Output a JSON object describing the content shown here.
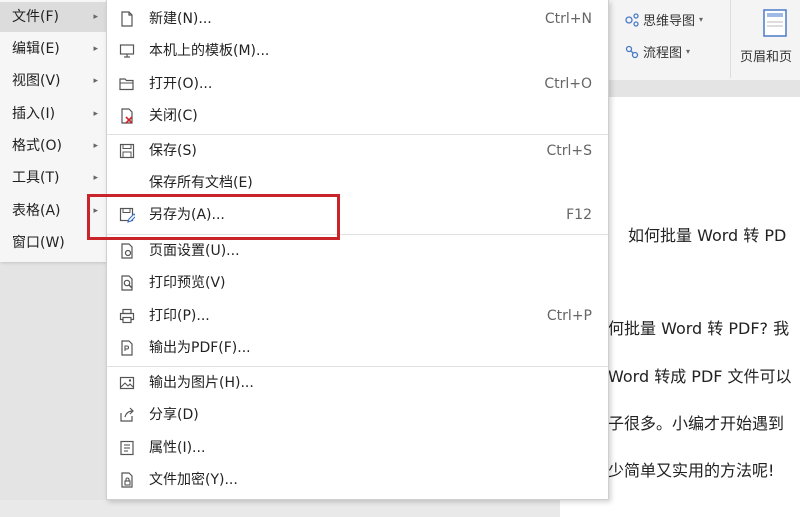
{
  "ribbon": {
    "mindmap_label": "思维导图",
    "flowchart_label": "流程图",
    "header_footer_label": "页眉和页"
  },
  "document": {
    "title": "如何批量 Word 转 PD",
    "lines": [
      "何批量 Word 转 PDF? 我",
      "Word 转成 PDF 文件可以",
      "子很多。小编才开始遇到",
      "少简单又实用的方法呢!"
    ]
  },
  "menubar": {
    "items": [
      {
        "label": "文件(F)"
      },
      {
        "label": "编辑(E)"
      },
      {
        "label": "视图(V)"
      },
      {
        "label": "插入(I)"
      },
      {
        "label": "格式(O)"
      },
      {
        "label": "工具(T)"
      },
      {
        "label": "表格(A)"
      },
      {
        "label": "窗口(W)"
      }
    ]
  },
  "file_menu": {
    "items": [
      {
        "label": "新建(N)...",
        "shortcut": "Ctrl+N",
        "icon": "new-file-icon"
      },
      {
        "label": "本机上的模板(M)...",
        "shortcut": "",
        "icon": "template-icon"
      },
      {
        "label": "打开(O)...",
        "shortcut": "Ctrl+O",
        "icon": "folder-open-icon"
      },
      {
        "label": "关闭(C)",
        "shortcut": "",
        "icon": "close-doc-icon"
      },
      {
        "label": "保存(S)",
        "shortcut": "Ctrl+S",
        "icon": "save-icon"
      },
      {
        "label": "保存所有文档(E)",
        "shortcut": "",
        "icon": ""
      },
      {
        "label": "另存为(A)...",
        "shortcut": "F12",
        "icon": "save-as-icon"
      },
      {
        "label": "页面设置(U)...",
        "shortcut": "",
        "icon": "page-setup-icon"
      },
      {
        "label": "打印预览(V)",
        "shortcut": "",
        "icon": "print-preview-icon"
      },
      {
        "label": "打印(P)...",
        "shortcut": "Ctrl+P",
        "icon": "printer-icon"
      },
      {
        "label": "输出为PDF(F)...",
        "shortcut": "",
        "icon": "export-pdf-icon"
      },
      {
        "label": "输出为图片(H)...",
        "shortcut": "",
        "icon": "export-image-icon"
      },
      {
        "label": "分享(D)",
        "shortcut": "",
        "icon": "share-icon"
      },
      {
        "label": "属性(I)...",
        "shortcut": "",
        "icon": "properties-icon"
      },
      {
        "label": "文件加密(Y)...",
        "shortcut": "",
        "icon": "encrypt-icon"
      }
    ]
  },
  "colors": {
    "highlight_border": "#c8242a",
    "icon_stroke": "#555555"
  }
}
